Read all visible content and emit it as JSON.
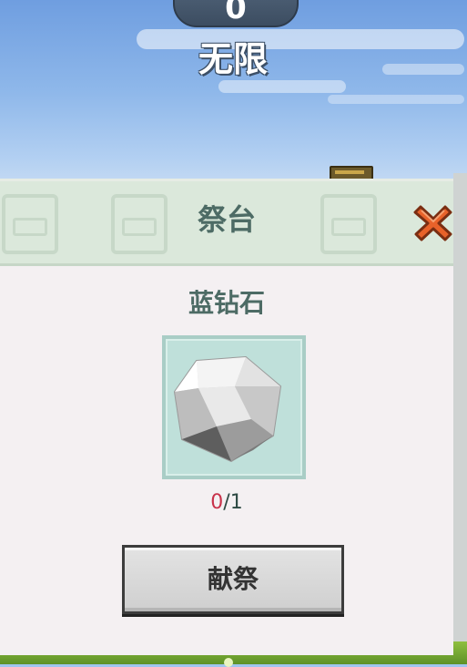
{
  "hud": {
    "count": "0",
    "label": "无限"
  },
  "dialog": {
    "title": "祭台",
    "item_name": "蓝钻石",
    "have": "0",
    "need": "/1",
    "button_label": "献祭"
  },
  "icons": {
    "close": "close-x-icon",
    "item": "diamond-icon"
  },
  "colors": {
    "title_text": "#4d6b65",
    "count_have": "#c8324a",
    "close_icon": "#e8622a",
    "slot_bg": "#bfe0da"
  }
}
